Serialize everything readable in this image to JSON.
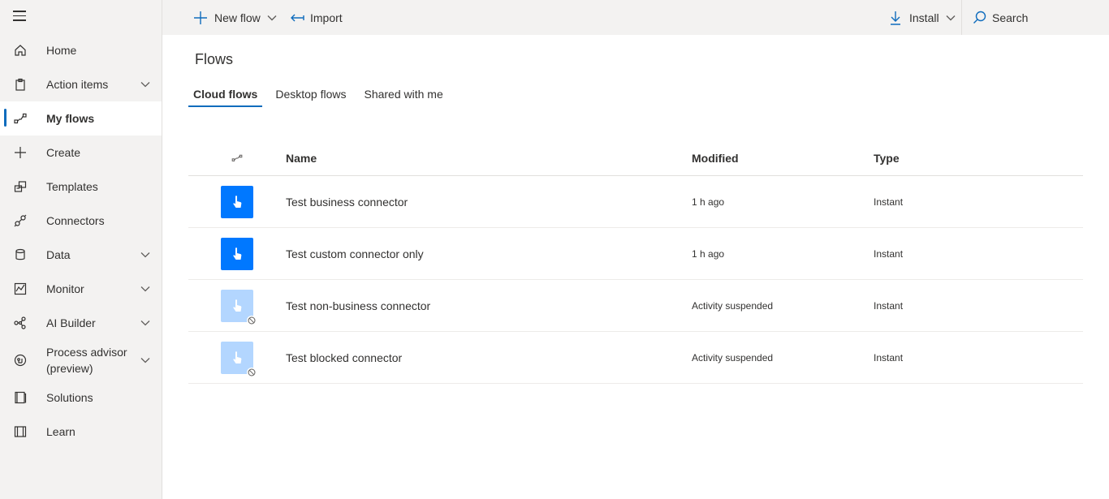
{
  "sidebar": {
    "items": [
      {
        "label": "Home",
        "icon": "home-icon"
      },
      {
        "label": "Action items",
        "icon": "clipboard-icon",
        "expandable": true
      },
      {
        "label": "My flows",
        "icon": "flow-icon",
        "active": true
      },
      {
        "label": "Create",
        "icon": "plus-icon"
      },
      {
        "label": "Templates",
        "icon": "templates-icon"
      },
      {
        "label": "Connectors",
        "icon": "connector-icon"
      },
      {
        "label": "Data",
        "icon": "database-icon",
        "expandable": true
      },
      {
        "label": "Monitor",
        "icon": "monitor-chart-icon",
        "expandable": true
      },
      {
        "label": "AI Builder",
        "icon": "ai-builder-icon",
        "expandable": true
      },
      {
        "label": "Process advisor (preview)",
        "line1": "Process advisor",
        "line2": "(preview)",
        "icon": "process-advisor-icon",
        "expandable": true
      },
      {
        "label": "Solutions",
        "icon": "solutions-icon"
      },
      {
        "label": "Learn",
        "icon": "book-icon"
      }
    ]
  },
  "toolbar": {
    "new_flow": "New flow",
    "import": "Import",
    "install": "Install",
    "search": "Search"
  },
  "page": {
    "title": "Flows",
    "tabs": [
      {
        "label": "Cloud flows",
        "active": true
      },
      {
        "label": "Desktop flows"
      },
      {
        "label": "Shared with me"
      }
    ]
  },
  "table": {
    "headers": {
      "name": "Name",
      "modified": "Modified",
      "type": "Type"
    },
    "rows": [
      {
        "name": "Test business connector",
        "modified": "1 h ago",
        "type": "Instant",
        "suspended": false
      },
      {
        "name": "Test custom connector only",
        "modified": "1 h ago",
        "type": "Instant",
        "suspended": false
      },
      {
        "name": "Test non-business connector",
        "modified": "Activity suspended",
        "type": "Instant",
        "suspended": true
      },
      {
        "name": "Test blocked connector",
        "modified": "Activity suspended",
        "type": "Instant",
        "suspended": true
      }
    ]
  },
  "colors": {
    "accent": "#0f6cbd",
    "flow_tile": "#0078ff",
    "flow_tile_suspended": "#b3d6ff"
  }
}
